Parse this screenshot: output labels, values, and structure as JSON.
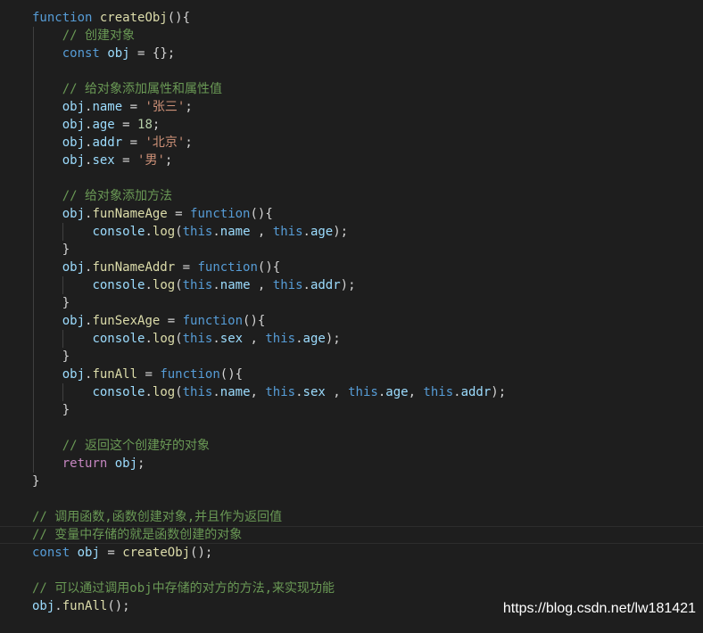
{
  "colors": {
    "background": "#1e1e1e",
    "keyword": "#569cd6",
    "function": "#dcdcaa",
    "variable": "#9cdcfe",
    "string": "#ce9178",
    "number": "#b5cea8",
    "comment": "#6a9955",
    "control": "#c586c0",
    "default": "#d4d4d4"
  },
  "lines": [
    {
      "tokens": [
        [
          "kw",
          "function"
        ],
        [
          "def",
          " "
        ],
        [
          "fn",
          "createObj"
        ],
        [
          "def",
          "(){"
        ]
      ]
    },
    {
      "tokens": [
        [
          "def",
          "    "
        ],
        [
          "cm",
          "// 创建对象"
        ]
      ]
    },
    {
      "tokens": [
        [
          "def",
          "    "
        ],
        [
          "kw",
          "const"
        ],
        [
          "def",
          " "
        ],
        [
          "var",
          "obj"
        ],
        [
          "def",
          " = {};"
        ]
      ]
    },
    {
      "tokens": []
    },
    {
      "tokens": [
        [
          "def",
          "    "
        ],
        [
          "cm",
          "// 给对象添加属性和属性值"
        ]
      ]
    },
    {
      "tokens": [
        [
          "def",
          "    "
        ],
        [
          "var",
          "obj"
        ],
        [
          "def",
          "."
        ],
        [
          "var",
          "name"
        ],
        [
          "def",
          " = "
        ],
        [
          "str",
          "'张三'"
        ],
        [
          "def",
          ";"
        ]
      ]
    },
    {
      "tokens": [
        [
          "def",
          "    "
        ],
        [
          "var",
          "obj"
        ],
        [
          "def",
          "."
        ],
        [
          "var",
          "age"
        ],
        [
          "def",
          " = "
        ],
        [
          "num",
          "18"
        ],
        [
          "def",
          ";"
        ]
      ]
    },
    {
      "tokens": [
        [
          "def",
          "    "
        ],
        [
          "var",
          "obj"
        ],
        [
          "def",
          "."
        ],
        [
          "var",
          "addr"
        ],
        [
          "def",
          " = "
        ],
        [
          "str",
          "'北京'"
        ],
        [
          "def",
          ";"
        ]
      ]
    },
    {
      "tokens": [
        [
          "def",
          "    "
        ],
        [
          "var",
          "obj"
        ],
        [
          "def",
          "."
        ],
        [
          "var",
          "sex"
        ],
        [
          "def",
          " = "
        ],
        [
          "str",
          "'男'"
        ],
        [
          "def",
          ";"
        ]
      ]
    },
    {
      "tokens": []
    },
    {
      "tokens": [
        [
          "def",
          "    "
        ],
        [
          "cm",
          "// 给对象添加方法"
        ]
      ]
    },
    {
      "tokens": [
        [
          "def",
          "    "
        ],
        [
          "var",
          "obj"
        ],
        [
          "def",
          "."
        ],
        [
          "fn",
          "funNameAge"
        ],
        [
          "def",
          " = "
        ],
        [
          "kw",
          "function"
        ],
        [
          "def",
          "(){"
        ]
      ]
    },
    {
      "tokens": [
        [
          "def",
          "        "
        ],
        [
          "var",
          "console"
        ],
        [
          "def",
          "."
        ],
        [
          "fn",
          "log"
        ],
        [
          "def",
          "("
        ],
        [
          "kw",
          "this"
        ],
        [
          "def",
          "."
        ],
        [
          "var",
          "name"
        ],
        [
          "def",
          " , "
        ],
        [
          "kw",
          "this"
        ],
        [
          "def",
          "."
        ],
        [
          "var",
          "age"
        ],
        [
          "def",
          ");"
        ]
      ]
    },
    {
      "tokens": [
        [
          "def",
          "    }"
        ]
      ]
    },
    {
      "tokens": [
        [
          "def",
          "    "
        ],
        [
          "var",
          "obj"
        ],
        [
          "def",
          "."
        ],
        [
          "fn",
          "funNameAddr"
        ],
        [
          "def",
          " = "
        ],
        [
          "kw",
          "function"
        ],
        [
          "def",
          "(){"
        ]
      ]
    },
    {
      "tokens": [
        [
          "def",
          "        "
        ],
        [
          "var",
          "console"
        ],
        [
          "def",
          "."
        ],
        [
          "fn",
          "log"
        ],
        [
          "def",
          "("
        ],
        [
          "kw",
          "this"
        ],
        [
          "def",
          "."
        ],
        [
          "var",
          "name"
        ],
        [
          "def",
          " , "
        ],
        [
          "kw",
          "this"
        ],
        [
          "def",
          "."
        ],
        [
          "var",
          "addr"
        ],
        [
          "def",
          ");"
        ]
      ]
    },
    {
      "tokens": [
        [
          "def",
          "    }"
        ]
      ]
    },
    {
      "tokens": [
        [
          "def",
          "    "
        ],
        [
          "var",
          "obj"
        ],
        [
          "def",
          "."
        ],
        [
          "fn",
          "funSexAge"
        ],
        [
          "def",
          " = "
        ],
        [
          "kw",
          "function"
        ],
        [
          "def",
          "(){"
        ]
      ]
    },
    {
      "tokens": [
        [
          "def",
          "        "
        ],
        [
          "var",
          "console"
        ],
        [
          "def",
          "."
        ],
        [
          "fn",
          "log"
        ],
        [
          "def",
          "("
        ],
        [
          "kw",
          "this"
        ],
        [
          "def",
          "."
        ],
        [
          "var",
          "sex"
        ],
        [
          "def",
          " , "
        ],
        [
          "kw",
          "this"
        ],
        [
          "def",
          "."
        ],
        [
          "var",
          "age"
        ],
        [
          "def",
          ");"
        ]
      ]
    },
    {
      "tokens": [
        [
          "def",
          "    }"
        ]
      ]
    },
    {
      "tokens": [
        [
          "def",
          "    "
        ],
        [
          "var",
          "obj"
        ],
        [
          "def",
          "."
        ],
        [
          "fn",
          "funAll"
        ],
        [
          "def",
          " = "
        ],
        [
          "kw",
          "function"
        ],
        [
          "def",
          "(){"
        ]
      ]
    },
    {
      "tokens": [
        [
          "def",
          "        "
        ],
        [
          "var",
          "console"
        ],
        [
          "def",
          "."
        ],
        [
          "fn",
          "log"
        ],
        [
          "def",
          "("
        ],
        [
          "kw",
          "this"
        ],
        [
          "def",
          "."
        ],
        [
          "var",
          "name"
        ],
        [
          "def",
          ", "
        ],
        [
          "kw",
          "this"
        ],
        [
          "def",
          "."
        ],
        [
          "var",
          "sex"
        ],
        [
          "def",
          " , "
        ],
        [
          "kw",
          "this"
        ],
        [
          "def",
          "."
        ],
        [
          "var",
          "age"
        ],
        [
          "def",
          ", "
        ],
        [
          "kw",
          "this"
        ],
        [
          "def",
          "."
        ],
        [
          "var",
          "addr"
        ],
        [
          "def",
          ");"
        ]
      ]
    },
    {
      "tokens": [
        [
          "def",
          "    }"
        ]
      ]
    },
    {
      "tokens": []
    },
    {
      "tokens": [
        [
          "def",
          "    "
        ],
        [
          "cm",
          "// 返回这个创建好的对象"
        ]
      ]
    },
    {
      "tokens": [
        [
          "def",
          "    "
        ],
        [
          "ctl",
          "return"
        ],
        [
          "def",
          " "
        ],
        [
          "var",
          "obj"
        ],
        [
          "def",
          ";"
        ]
      ]
    },
    {
      "tokens": [
        [
          "def",
          "}"
        ]
      ]
    },
    {
      "tokens": []
    },
    {
      "tokens": [
        [
          "cm",
          "// 调用函数,函数创建对象,并且作为返回值"
        ]
      ]
    },
    {
      "tokens": [
        [
          "cm",
          "// 变量中存储的就是函数创建的对象"
        ]
      ],
      "highlight": true
    },
    {
      "tokens": [
        [
          "kw",
          "const"
        ],
        [
          "def",
          " "
        ],
        [
          "var",
          "obj"
        ],
        [
          "def",
          " = "
        ],
        [
          "fn",
          "createObj"
        ],
        [
          "def",
          "();"
        ]
      ]
    },
    {
      "tokens": []
    },
    {
      "tokens": [
        [
          "cm",
          "// 可以通过调用obj中存储的对方的方法,来实现功能"
        ]
      ]
    },
    {
      "tokens": [
        [
          "var",
          "obj"
        ],
        [
          "def",
          "."
        ],
        [
          "fn",
          "funAll"
        ],
        [
          "def",
          "();"
        ]
      ]
    }
  ],
  "watermark": "https://blog.csdn.net/lw181421"
}
